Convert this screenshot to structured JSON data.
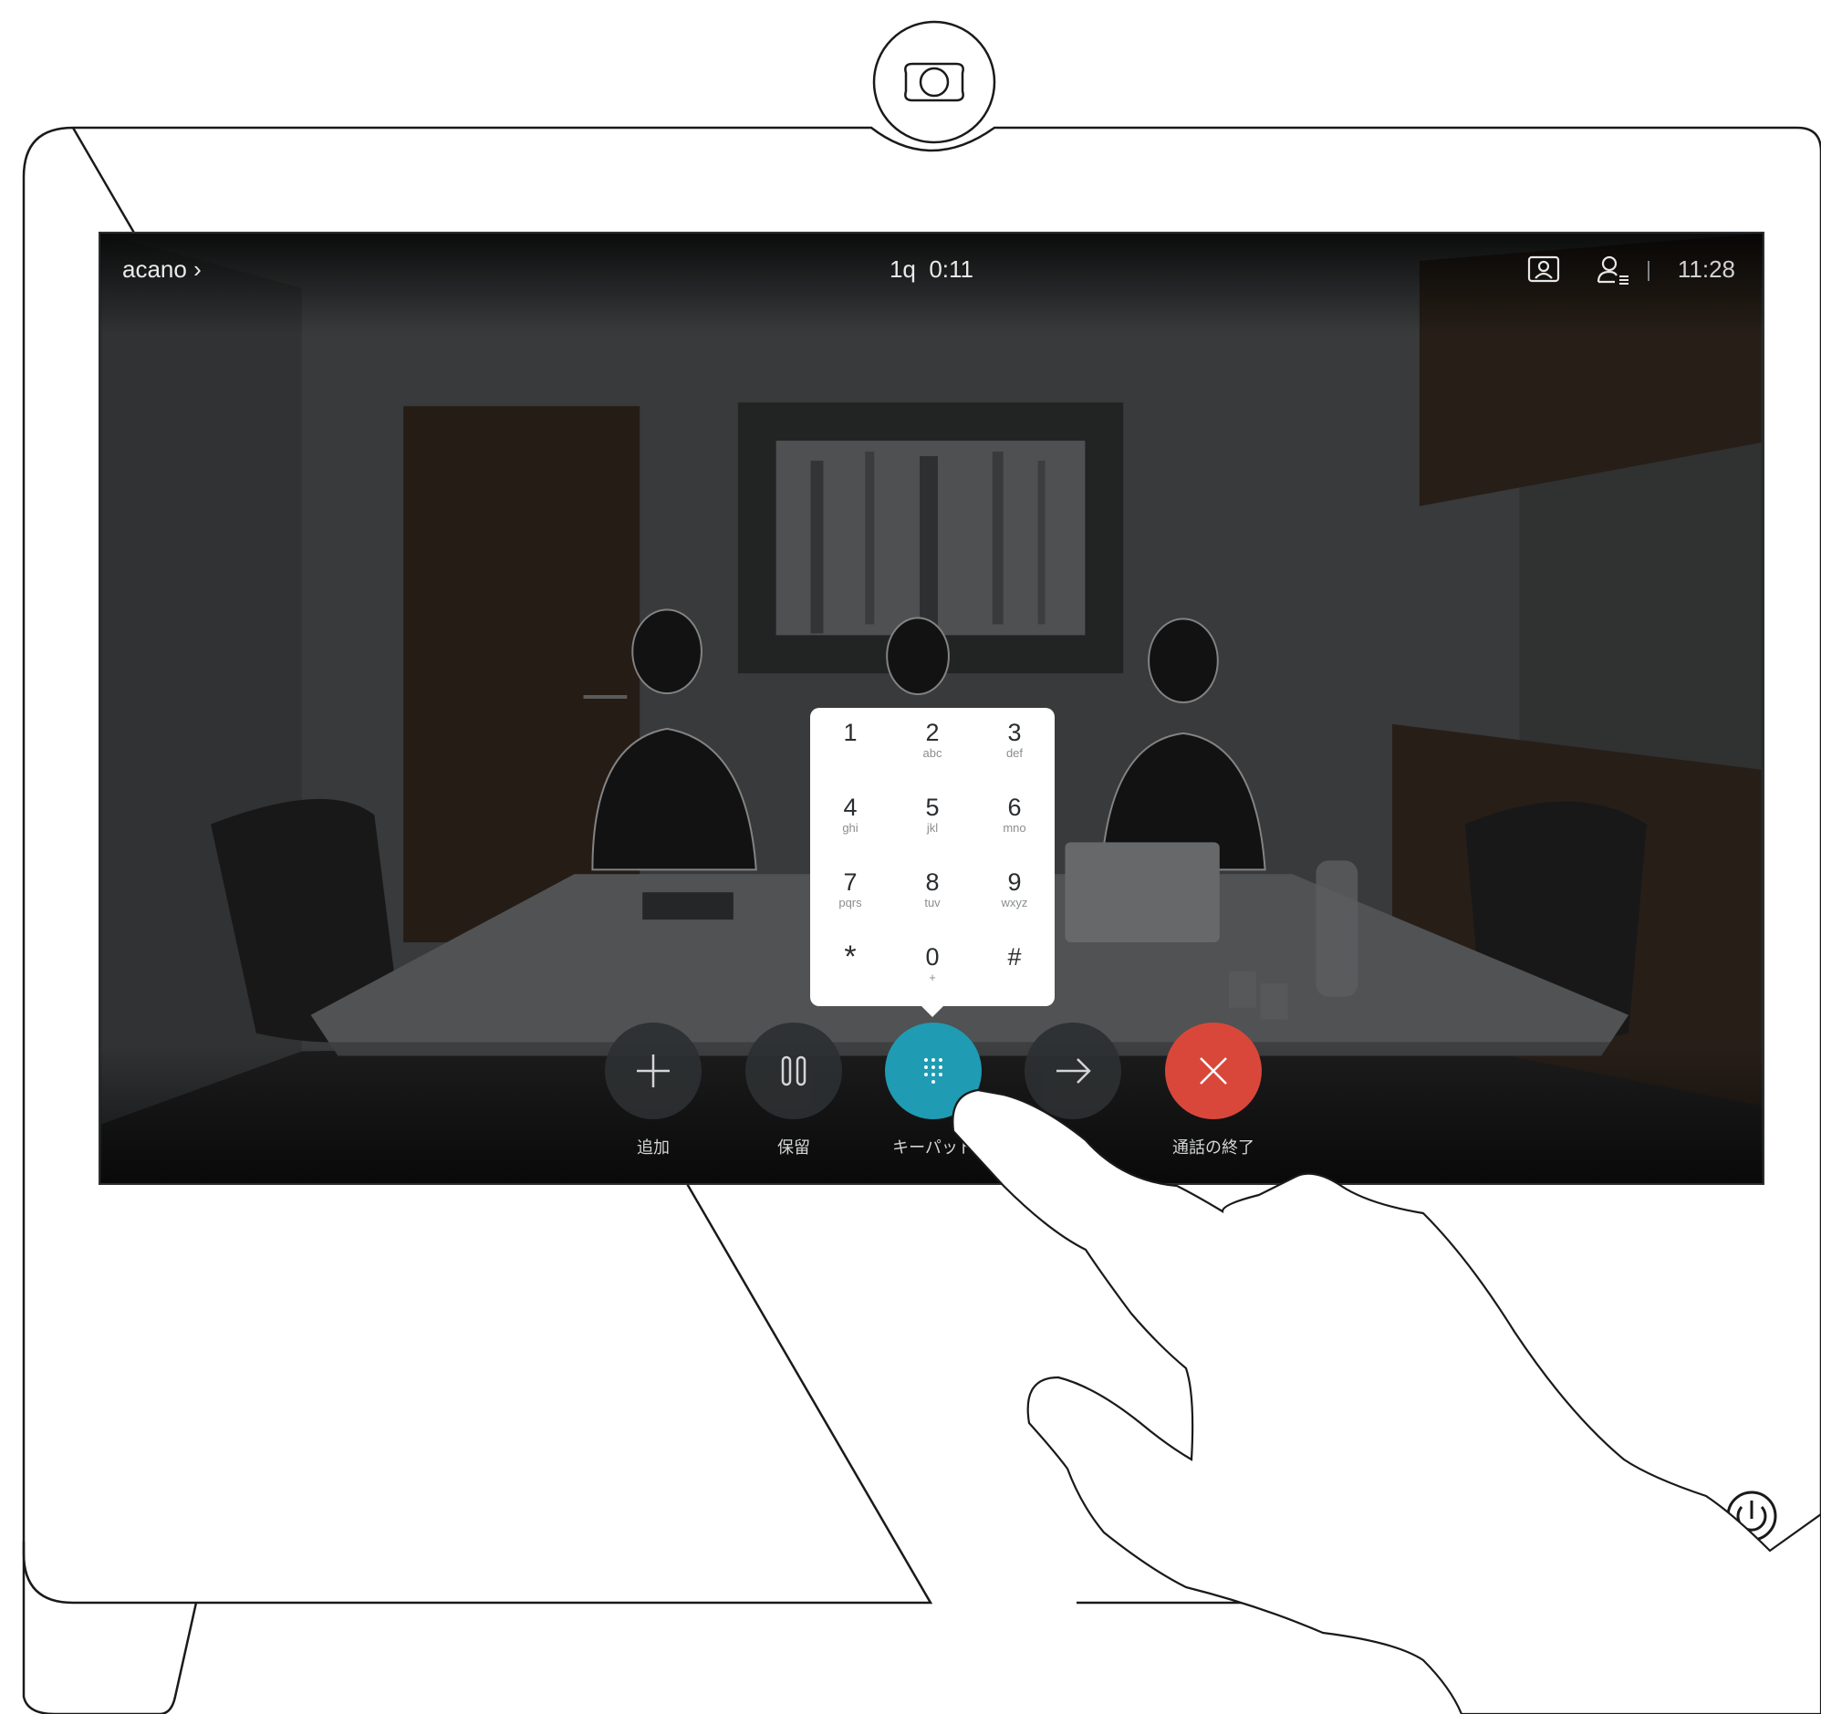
{
  "topbar": {
    "site_name": "acano",
    "call_name": "1q",
    "call_duration": "0:11",
    "clock": "11:28"
  },
  "keypad": {
    "keys": [
      {
        "digit": "1",
        "letters": ""
      },
      {
        "digit": "2",
        "letters": "abc"
      },
      {
        "digit": "3",
        "letters": "def"
      },
      {
        "digit": "4",
        "letters": "ghi"
      },
      {
        "digit": "5",
        "letters": "jkl"
      },
      {
        "digit": "6",
        "letters": "mno"
      },
      {
        "digit": "7",
        "letters": "pqrs"
      },
      {
        "digit": "8",
        "letters": "tuv"
      },
      {
        "digit": "9",
        "letters": "wxyz"
      },
      {
        "digit": "*",
        "letters": ""
      },
      {
        "digit": "0",
        "letters": "+"
      },
      {
        "digit": "#",
        "letters": ""
      }
    ]
  },
  "controls": {
    "add_label": "追加",
    "hold_label": "保留",
    "keypad_label": "キーパッド",
    "transfer_label": "",
    "end_label": "通話の終了"
  },
  "colors": {
    "keypad_active": "#1f9bb3",
    "end_call": "#d9473b",
    "control_bg": "#2d3032"
  }
}
